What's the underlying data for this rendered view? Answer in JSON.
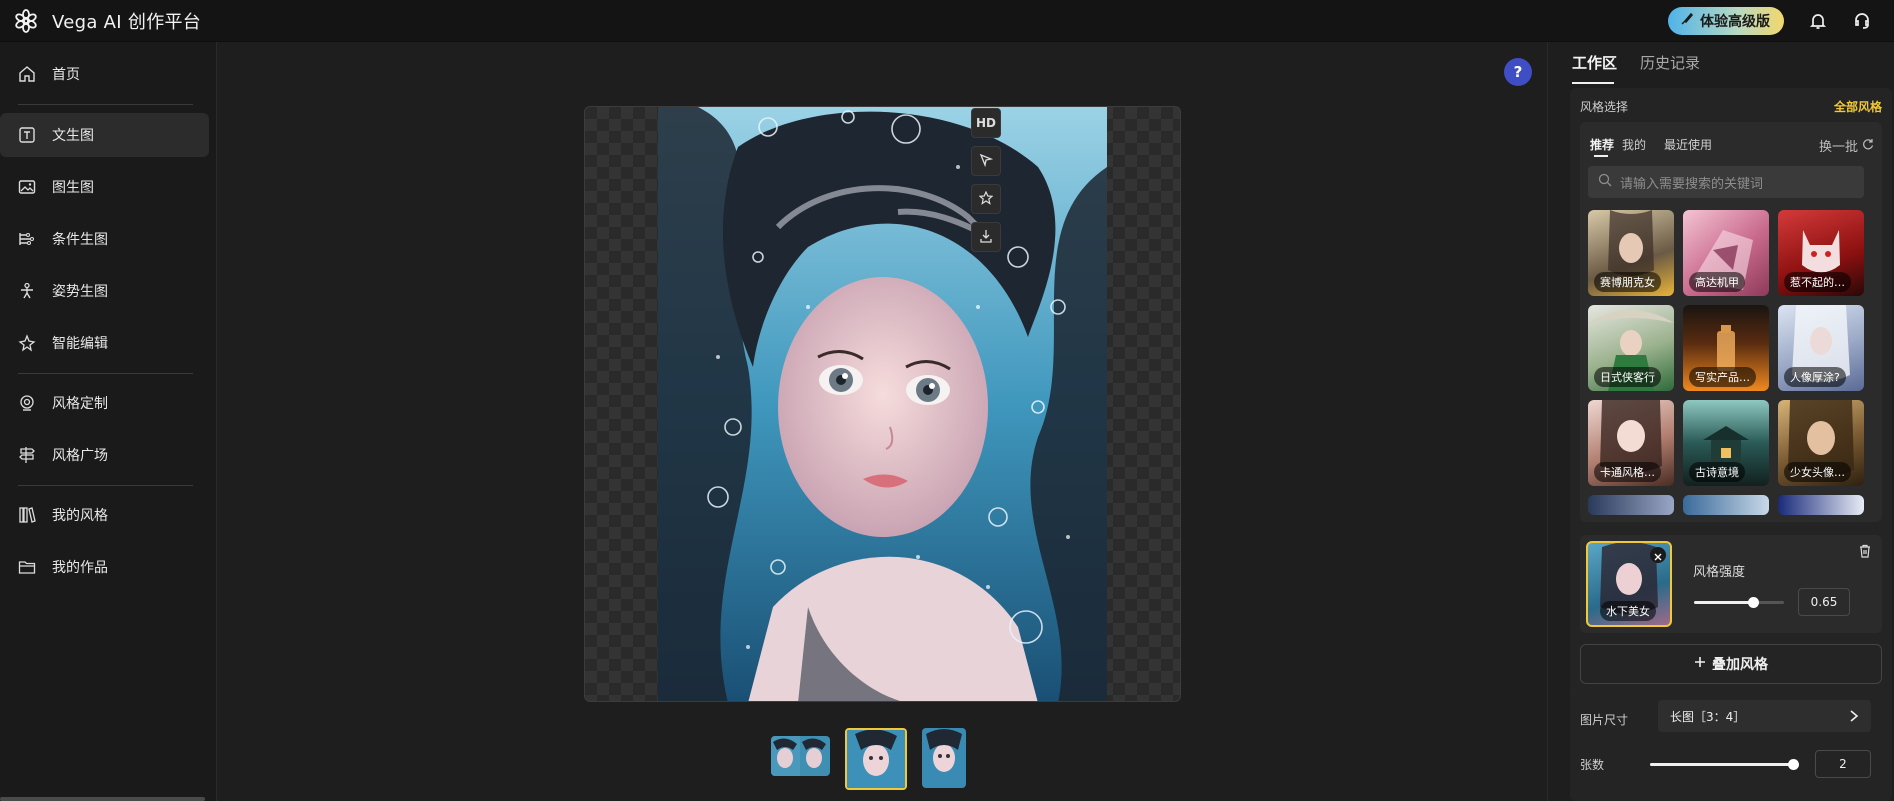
{
  "app": {
    "title": "Vega AI 创作平台"
  },
  "topbar": {
    "upgrade_label": "体验高级版",
    "bell_icon": "bell-icon",
    "support_icon": "headset-icon"
  },
  "sidebar": {
    "items": [
      {
        "label": "首页",
        "icon": "home-icon"
      },
      {
        "label": "文生图",
        "icon": "text-image-icon",
        "active": true
      },
      {
        "label": "图生图",
        "icon": "image-icon"
      },
      {
        "label": "条件生图",
        "icon": "conditions-icon"
      },
      {
        "label": "姿势生图",
        "icon": "pose-icon"
      },
      {
        "label": "智能编辑",
        "icon": "magic-edit-icon"
      },
      {
        "label": "风格定制",
        "icon": "target-icon"
      },
      {
        "label": "风格广场",
        "icon": "signpost-icon"
      },
      {
        "label": "我的风格",
        "icon": "library-icon"
      },
      {
        "label": "我的作品",
        "icon": "folder-icon"
      }
    ]
  },
  "canvas": {
    "hd_label": "HD",
    "help": "?"
  },
  "panel": {
    "tabs": [
      "工作区",
      "历史记录"
    ],
    "style_section_label": "风格选择",
    "all_styles_label": "全部风格",
    "subtabs": [
      "推荐",
      "我的",
      "最近使用"
    ],
    "refresh_label": "换一批",
    "search_placeholder": "请输入需要搜索的关键词",
    "tiles": [
      "赛博朋克女",
      "高达机甲",
      "惹不起的…",
      "日式侠客行",
      "写实产品…",
      "人像厚涂?",
      "卡通风格…",
      "古诗意境",
      "少女头像…"
    ],
    "selected_style": {
      "name": "水下美女",
      "strength_label": "风格强度",
      "strength_value": "0.65",
      "strength": 0.65
    },
    "add_style_label": "叠加风格",
    "image_size": {
      "label": "图片尺寸",
      "value": "长图［3：4］"
    },
    "count": {
      "label": "张数",
      "value": "2"
    }
  },
  "colors": {
    "accent": "#f0c93a",
    "help": "#3f4ec4",
    "background": "#1e1e1e"
  }
}
